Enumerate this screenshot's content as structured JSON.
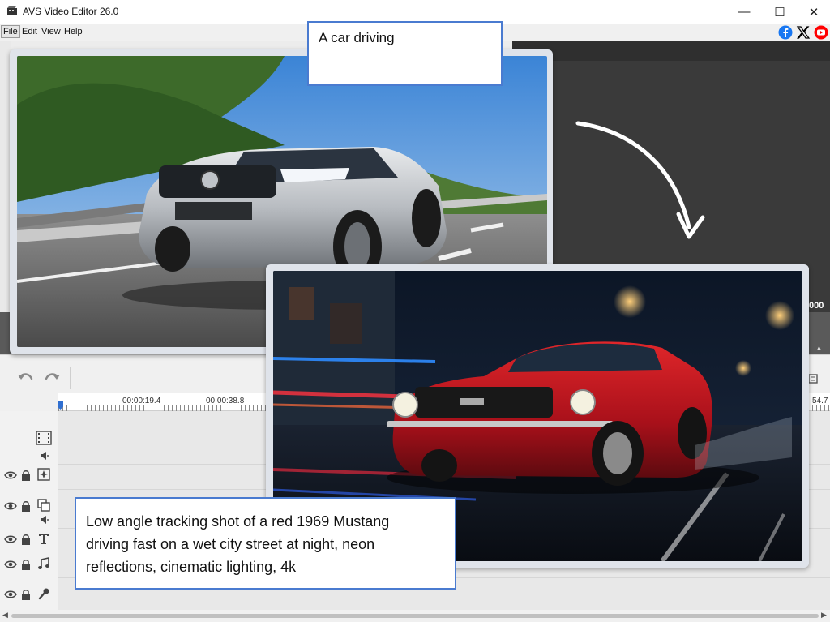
{
  "window": {
    "title": "AVS Video Editor 26.0",
    "minimize_glyph": "—",
    "maximize_glyph": "☐",
    "close_glyph": "✕"
  },
  "menu": {
    "items": [
      {
        "label": "File"
      },
      {
        "label": "Edit"
      },
      {
        "label": "View"
      },
      {
        "label": "Help"
      }
    ]
  },
  "social": {
    "icons": [
      "facebook-icon",
      "x-icon",
      "youtube-icon"
    ],
    "colors": {
      "facebook": "#1877f2",
      "x": "#000000",
      "youtube": "#ff0000"
    }
  },
  "preview": {
    "time_readout": ".000"
  },
  "timeline": {
    "ruler_labels": [
      "00:00:19.4",
      "00:00:38.8",
      "54.7"
    ],
    "tools": [
      "undo-icon",
      "redo-icon"
    ],
    "tracks": [
      {
        "name": "video-track",
        "icons": [
          "film-icon"
        ]
      },
      {
        "name": "video-audio-track",
        "icons": [
          "speaker-mute-icon"
        ]
      },
      {
        "name": "effects-track",
        "icons": [
          "eye-icon",
          "lock-icon",
          "effects-icon"
        ]
      },
      {
        "name": "overlay-track",
        "icons": [
          "eye-icon",
          "lock-icon",
          "overlay-icon",
          "speaker-mute-icon"
        ]
      },
      {
        "name": "text-track",
        "icons": [
          "eye-icon",
          "lock-icon",
          "text-icon"
        ]
      },
      {
        "name": "music-track",
        "icons": [
          "eye-icon",
          "lock-icon",
          "music-icon"
        ]
      },
      {
        "name": "voice-track",
        "icons": [
          "eye-icon",
          "lock-icon",
          "microphone-icon"
        ]
      }
    ]
  },
  "overlays": {
    "image_1": {
      "subject": "silver sedan driving on a highway"
    },
    "image_2": {
      "subject": "red muscle car on a wet city street at night"
    },
    "caption_1": "A car driving",
    "caption_2_lines": [
      "Low angle tracking shot of a red 1969 Mustang",
      "driving fast on a wet city street at night, neon",
      "reflections, cinematic lighting, 4k"
    ]
  },
  "colors": {
    "accent": "#4a7bd0",
    "preview_bg": "#3a3a3a",
    "playhead": "#2f6fd1"
  }
}
